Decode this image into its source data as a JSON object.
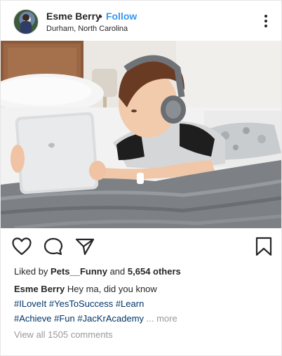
{
  "header": {
    "username": "Esme Berry",
    "separator": "•",
    "follow_label": "Follow",
    "location": "Durham, North Carolina"
  },
  "photo": {
    "subject": "boy-with-headphones-using-tablet"
  },
  "actions": {
    "icons": [
      "heart-icon",
      "comment-icon",
      "paper-plane-icon",
      "bookmark-icon"
    ]
  },
  "likes": {
    "prefix": "Liked by ",
    "user": "Pets__Funny",
    "middle": " and ",
    "others": "5,654 others"
  },
  "caption": {
    "username": "Esme Berry",
    "text": "Hey ma, did you know",
    "tags_line1": [
      "#ILoveIt",
      "#YesToSuccess",
      "#Learn"
    ],
    "tags_line2": [
      "#Achieve",
      "#Fun",
      "#JacKrAcademy"
    ],
    "more_label": "... more"
  },
  "comments": {
    "view_all": "View all 1505 comments"
  },
  "colors": {
    "link_blue": "#3897f0",
    "hashtag": "#003569",
    "muted": "#999999",
    "text": "#262626"
  }
}
